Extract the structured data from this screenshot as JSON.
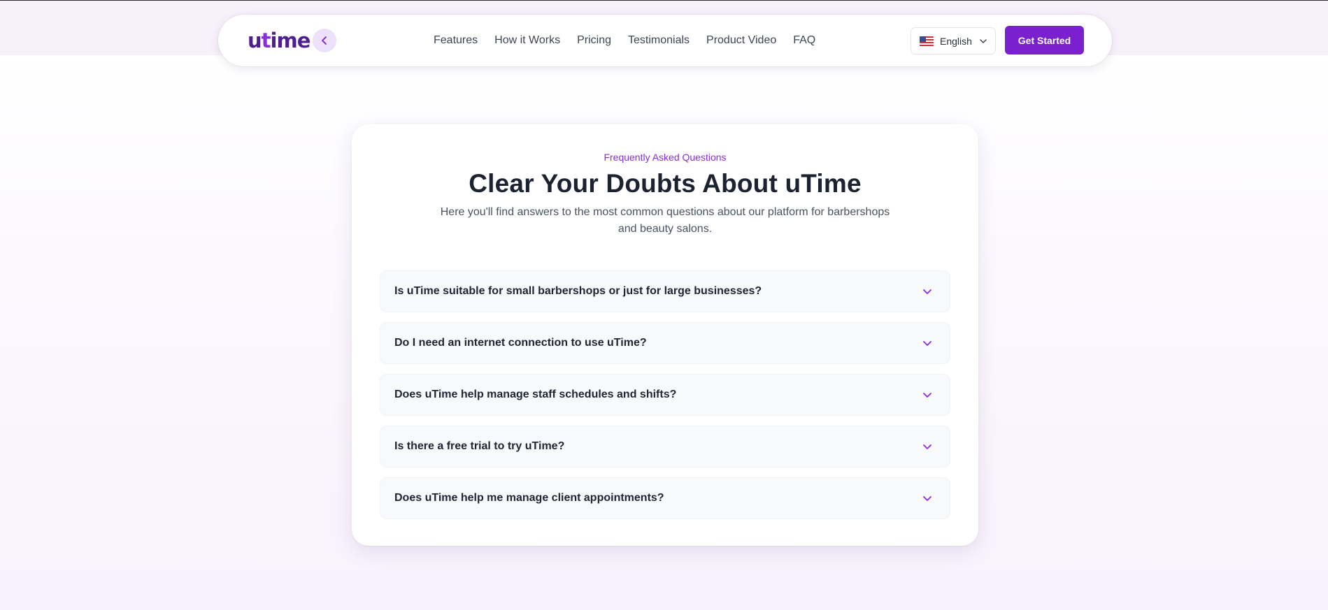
{
  "brand": {
    "logo_text_prefix": "u",
    "logo_text_accent": "t",
    "logo_text_suffix": "ime",
    "colors": {
      "primary": "#7a20cf",
      "accent": "#8a2be2",
      "logo": "#4f1f8e"
    }
  },
  "nav": {
    "links": [
      {
        "label": "Features"
      },
      {
        "label": "How it Works"
      },
      {
        "label": "Pricing"
      },
      {
        "label": "Testimonials"
      },
      {
        "label": "Product Video"
      },
      {
        "label": "FAQ"
      }
    ],
    "language": {
      "selected": "English",
      "flag": "us-flag-icon"
    },
    "cta_label": "Get Started"
  },
  "faq": {
    "eyebrow": "Frequently Asked Questions",
    "title": "Clear Your Doubts About uTime",
    "subtitle": "Here you'll find answers to the most common questions about our platform for barbershops and beauty salons.",
    "items": [
      {
        "question": "Is uTime suitable for small barbershops or just for large businesses?"
      },
      {
        "question": "Do I need an internet connection to use uTime?"
      },
      {
        "question": "Does uTime help manage staff schedules and shifts?"
      },
      {
        "question": "Is there a free trial to try uTime?"
      },
      {
        "question": "Does uTime help me manage client appointments?"
      }
    ]
  }
}
